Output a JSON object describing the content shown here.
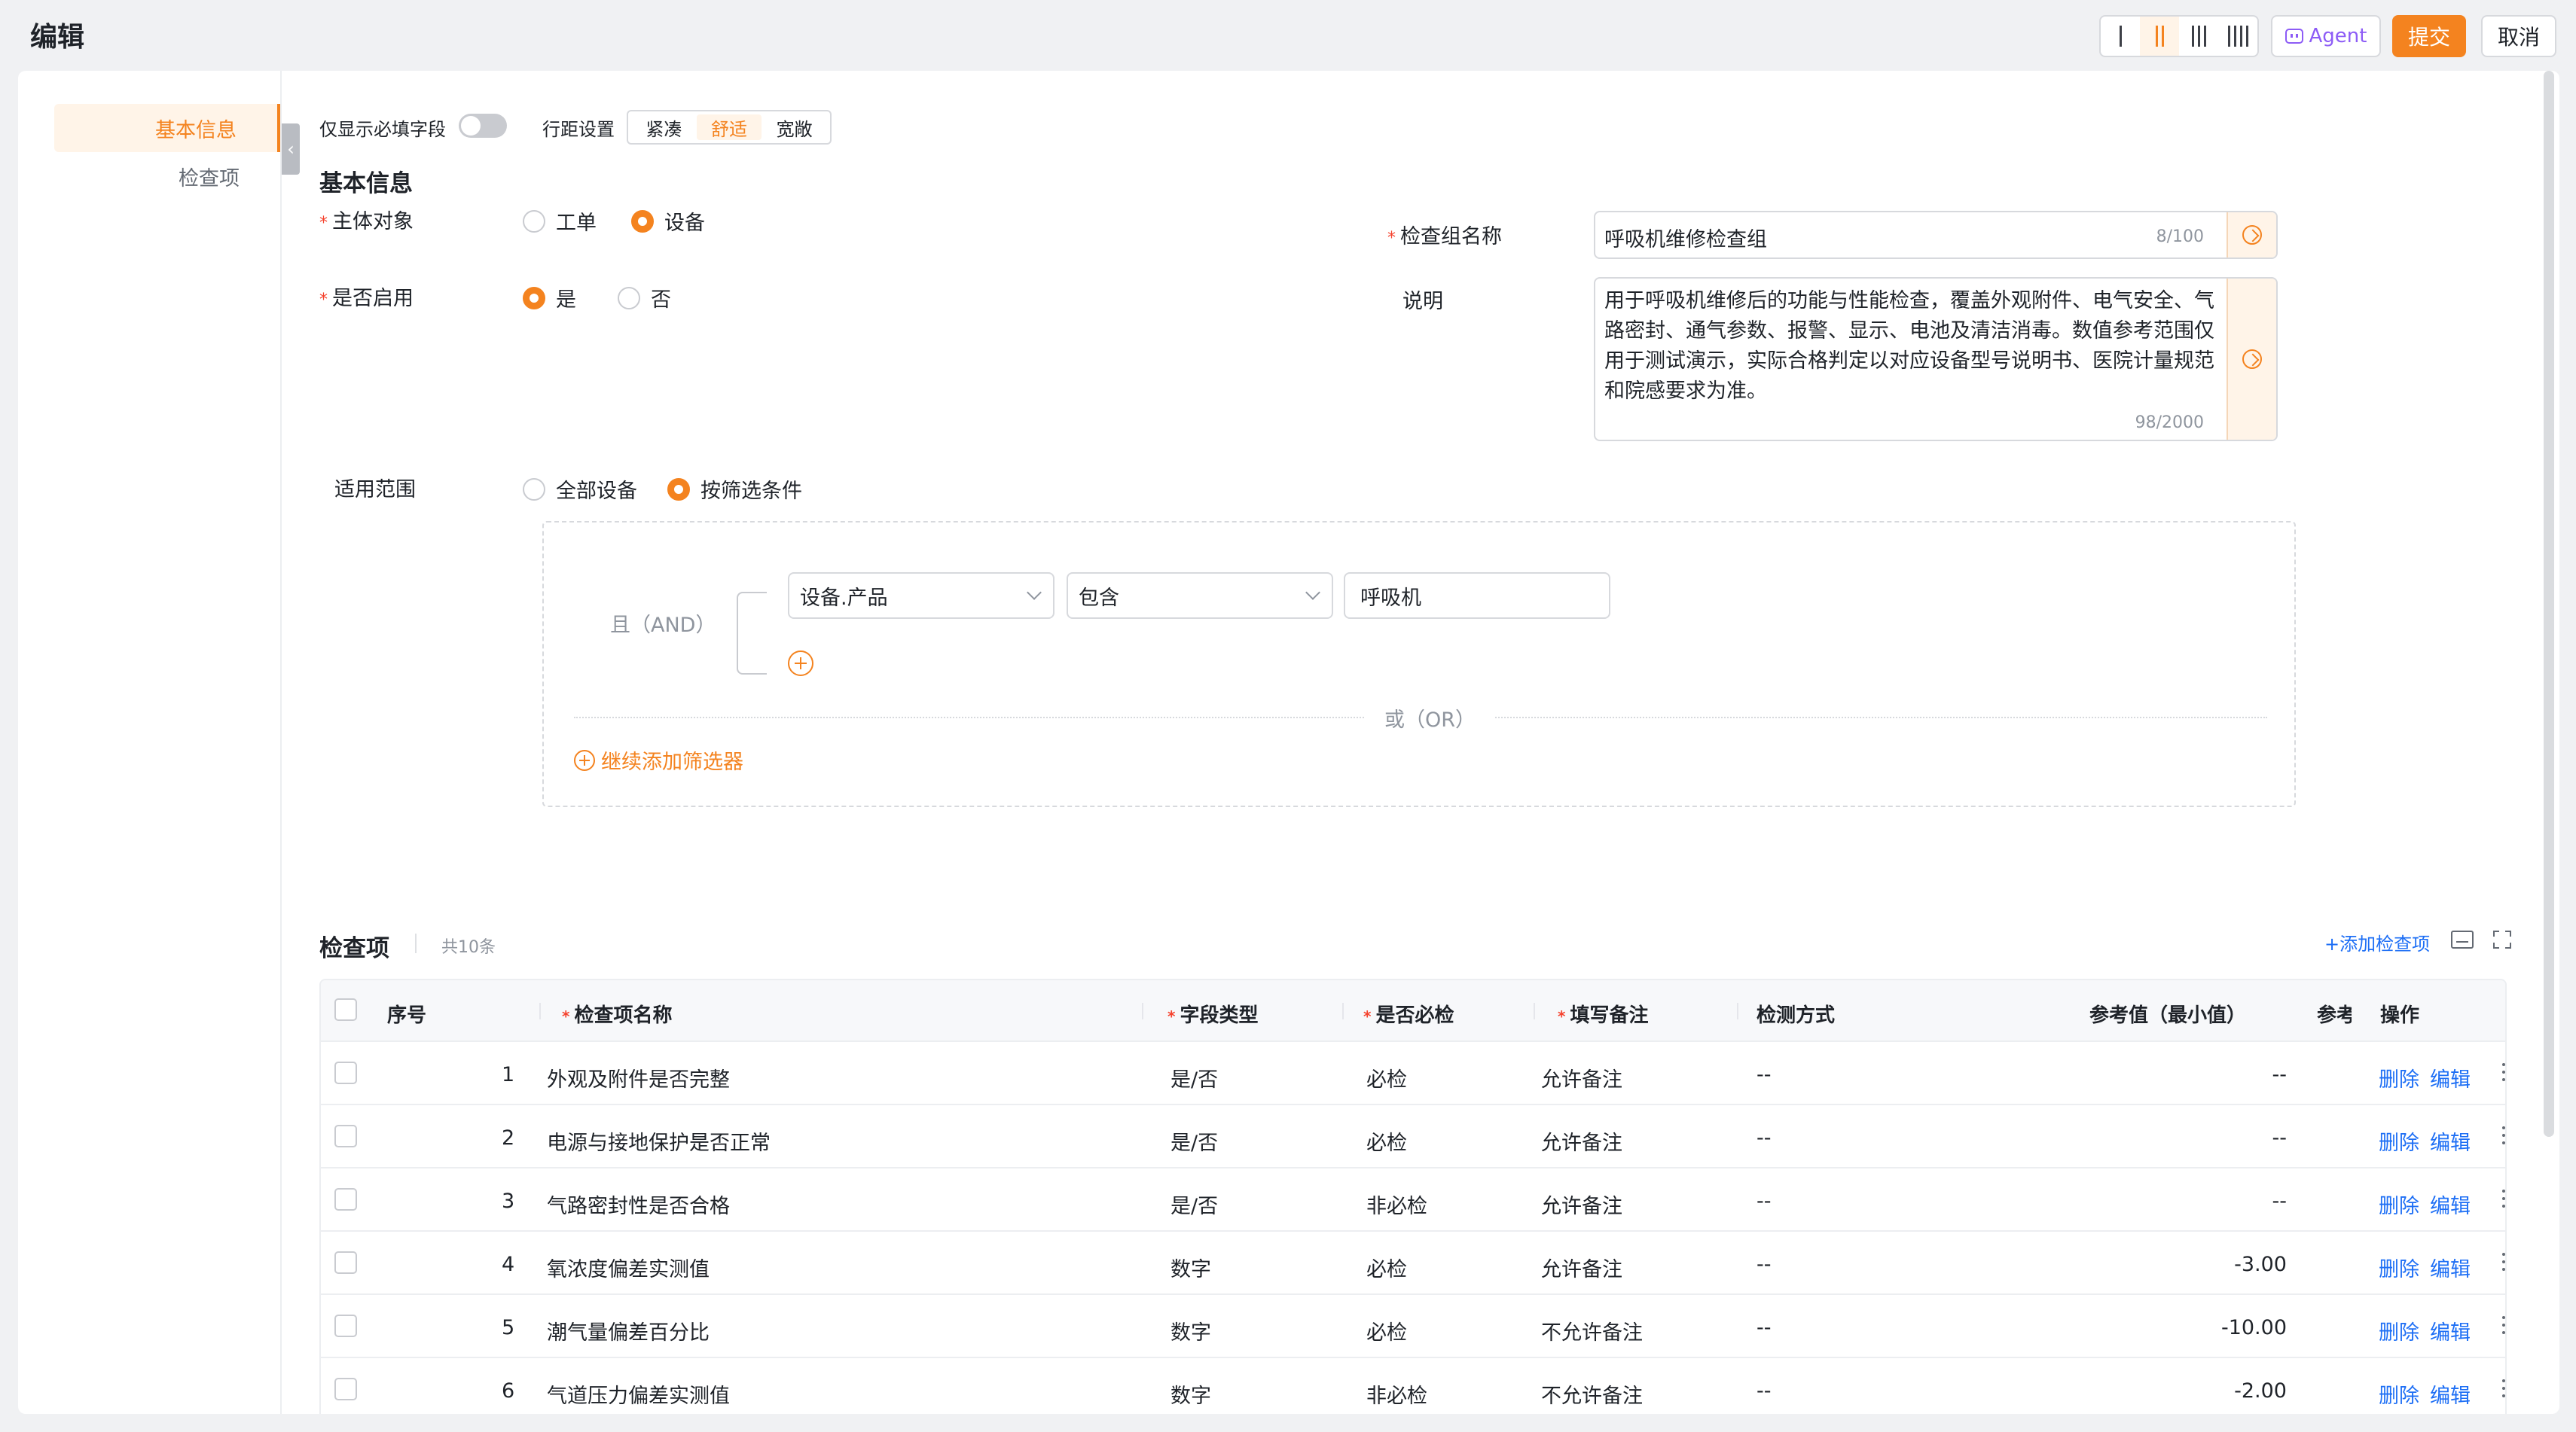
{
  "header": {
    "title": "编辑",
    "agent_label": "Agent",
    "submit_label": "提交",
    "cancel_label": "取消",
    "density_options": [
      "1-bar",
      "2-bar",
      "3-bar",
      "4-bar"
    ],
    "density_selected": "2-bar"
  },
  "sidebar": {
    "items": [
      {
        "label": "基本信息",
        "active": true
      },
      {
        "label": "检查项",
        "active": false
      }
    ]
  },
  "toolbar": {
    "required_only_label": "仅显示必填字段",
    "required_only_on": false,
    "row_spacing_label": "行距设置",
    "spacing_options": [
      "紧凑",
      "舒适",
      "宽敞"
    ],
    "spacing_selected": "舒适"
  },
  "basic": {
    "section_title": "基本信息",
    "subject": {
      "label": "主体对象",
      "options": [
        "工单",
        "设备"
      ],
      "selected": "设备"
    },
    "enabled": {
      "label": "是否启用",
      "options": [
        "是",
        "否"
      ],
      "selected": "是"
    },
    "group_name": {
      "label": "检查组名称",
      "value": "呼吸机维修检查组",
      "count": "8/100"
    },
    "description": {
      "label": "说明",
      "value": "用于呼吸机维修后的功能与性能检查，覆盖外观附件、电气安全、气路密封、通气参数、报警、显示、电池及清洁消毒。数值参考范围仅用于测试演示，实际合格判定以对应设备型号说明书、医院计量规范和院感要求为准。",
      "count": "98/2000"
    },
    "scope": {
      "label": "适用范围",
      "options": [
        "全部设备",
        "按筛选条件"
      ],
      "selected": "按筛选条件"
    },
    "filter": {
      "and_label": "且（AND）",
      "field": "设备.产品",
      "operator": "包含",
      "value": "呼吸机",
      "or_label": "或（OR）",
      "add_filter_label": "继续添加筛选器"
    }
  },
  "items": {
    "title": "检查项",
    "count": "共10条",
    "add_label": "+添加检查项",
    "columns": [
      "序号",
      "检查项名称",
      "字段类型",
      "是否必检",
      "填写备注",
      "检测方式",
      "参考值（最小值）",
      "参考值",
      "操作"
    ],
    "rows": [
      {
        "no": "1",
        "name": "外观及附件是否完整",
        "type": "是/否",
        "required": "必检",
        "note": "允许备注",
        "method": "--",
        "min": "--",
        "del": "删除",
        "edit": "编辑"
      },
      {
        "no": "2",
        "name": "电源与接地保护是否正常",
        "type": "是/否",
        "required": "必检",
        "note": "允许备注",
        "method": "--",
        "min": "--",
        "del": "删除",
        "edit": "编辑"
      },
      {
        "no": "3",
        "name": "气路密封性是否合格",
        "type": "是/否",
        "required": "非必检",
        "note": "允许备注",
        "method": "--",
        "min": "--",
        "del": "删除",
        "edit": "编辑"
      },
      {
        "no": "4",
        "name": "氧浓度偏差实测值",
        "type": "数字",
        "required": "必检",
        "note": "允许备注",
        "method": "--",
        "min": "-3.00",
        "del": "删除",
        "edit": "编辑"
      },
      {
        "no": "5",
        "name": "潮气量偏差百分比",
        "type": "数字",
        "required": "必检",
        "note": "不允许备注",
        "method": "--",
        "min": "-10.00",
        "del": "删除",
        "edit": "编辑"
      },
      {
        "no": "6",
        "name": "气道压力偏差实测值",
        "type": "数字",
        "required": "非必检",
        "note": "不允许备注",
        "method": "--",
        "min": "-2.00",
        "del": "删除",
        "edit": "编辑"
      }
    ]
  },
  "colors": {
    "accent": "#f4831f",
    "link": "#1e6ff5",
    "required_star": "#f5432e",
    "agent": "#8d5cf6"
  }
}
